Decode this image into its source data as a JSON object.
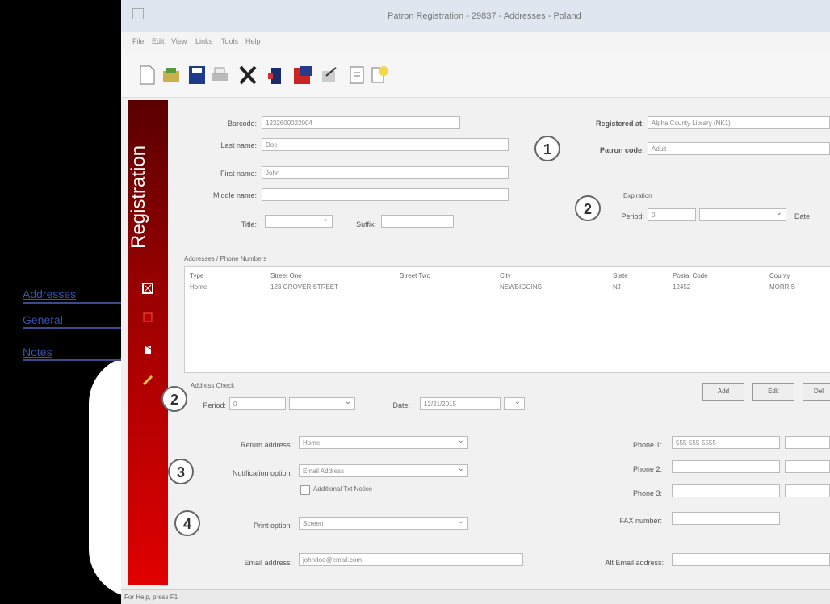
{
  "window": {
    "title": "Patron Registration - 29837 - Addresses - Poland"
  },
  "menu": [
    "File",
    "Edit",
    "View",
    "Links",
    "Tools",
    "Help"
  ],
  "toolbar_icons": [
    "new-icon",
    "open-icon",
    "save-icon",
    "print-icon",
    "cut-icon",
    "user-icon",
    "card-icon",
    "edit-icon",
    "document-icon",
    "help-icon"
  ],
  "sidebar": {
    "title": "Registration"
  },
  "callouts": {
    "addresses": "Addresses",
    "general": "General",
    "notes": "Notes"
  },
  "form": {
    "barcode_label": "Barcode:",
    "barcode": "1232600022004",
    "last_name_label": "Last name:",
    "last_name": "Doe",
    "first_name_label": "First name:",
    "first_name": "John",
    "middle_name_label": "Middle name:",
    "middle_name": "",
    "title_label": "Title:",
    "title": "",
    "suffix_label": "Suffix:",
    "suffix": "",
    "registered_at_label": "Registered at:",
    "registered_at": "Alpha County Library (NK1)",
    "patron_code_label": "Patron code:",
    "patron_code": "Adult",
    "expiration_label": "Expiration",
    "period_label": "Period:",
    "period_value": "0",
    "date_label": "Date"
  },
  "addresses": {
    "section_label": "Addresses / Phone Numbers",
    "columns": [
      "Type",
      "Street One",
      "Street Two",
      "City",
      "State",
      "Postal Code",
      "County"
    ],
    "rows": [
      [
        "Home",
        "123 GROVER STREET",
        "",
        "NEWBIGGINS",
        "NJ",
        "12452",
        "MORRIS"
      ]
    ]
  },
  "address_check": {
    "label": "Address Check",
    "period_label": "Period:",
    "period_value": "0",
    "date_label": "Date:",
    "date_value": "12/21/2015"
  },
  "buttons": {
    "add": "Add",
    "edit": "Edit",
    "delete": "Del"
  },
  "contact": {
    "return_addr_label": "Return address:",
    "return_addr": "Home",
    "notification_label": "Notification option:",
    "notification": "Email Address",
    "additional_text_label": "Additional Txt Notice",
    "print_label": "Print option:",
    "print_option": "Screen",
    "email_label": "Email address:",
    "email": "johndoe@email.com",
    "phone1_label": "Phone 1:",
    "phone1": "555-555-5555",
    "phone2_label": "Phone 2:",
    "phone2": "",
    "phone3_label": "Phone 3:",
    "phone3": "",
    "fax_label": "FAX number:",
    "fax": "",
    "alt_email_label": "Alt Email address:",
    "alt_email": ""
  },
  "markers": {
    "m1": "1",
    "m2": "2",
    "m2b": "2",
    "m3": "3",
    "m4": "4"
  },
  "status": "For Help, press F1"
}
